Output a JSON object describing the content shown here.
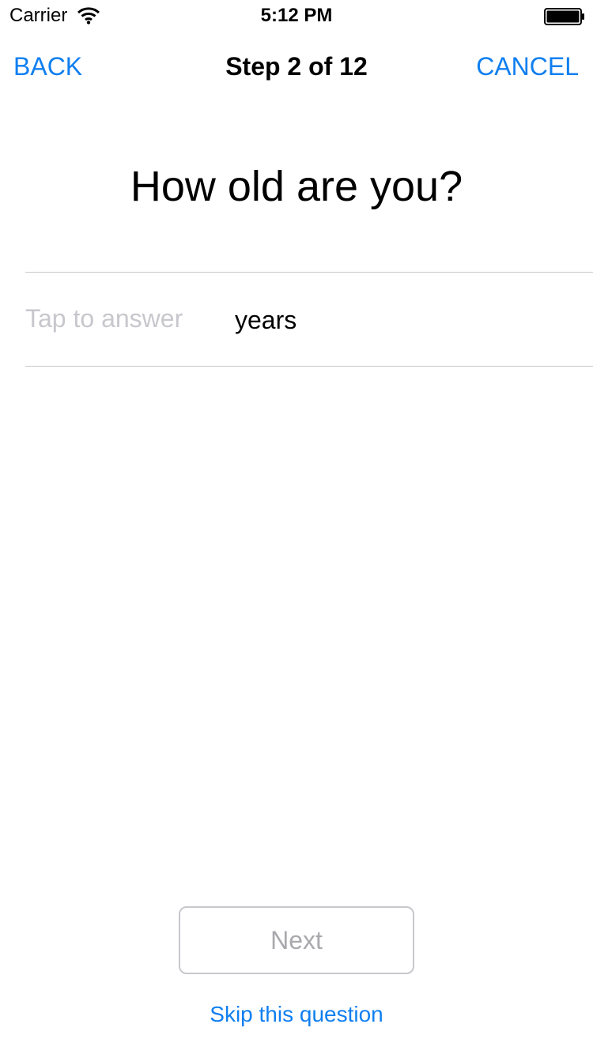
{
  "status_bar": {
    "carrier": "Carrier",
    "time": "5:12 PM",
    "wifi_icon": "wifi-icon",
    "battery_icon": "battery-icon"
  },
  "nav": {
    "back_label": "BACK",
    "title": "Step 2 of 12",
    "cancel_label": "CANCEL"
  },
  "question": {
    "text": "How old are you?"
  },
  "answer": {
    "placeholder": "Tap to answer",
    "value": "",
    "unit": "years"
  },
  "actions": {
    "next_label": "Next",
    "skip_label": "Skip this question"
  },
  "colors": {
    "accent": "#0f7ff0",
    "divider": "#c8c7cc",
    "disabled_text": "#a8a8ad",
    "placeholder": "#c7c7cd"
  }
}
